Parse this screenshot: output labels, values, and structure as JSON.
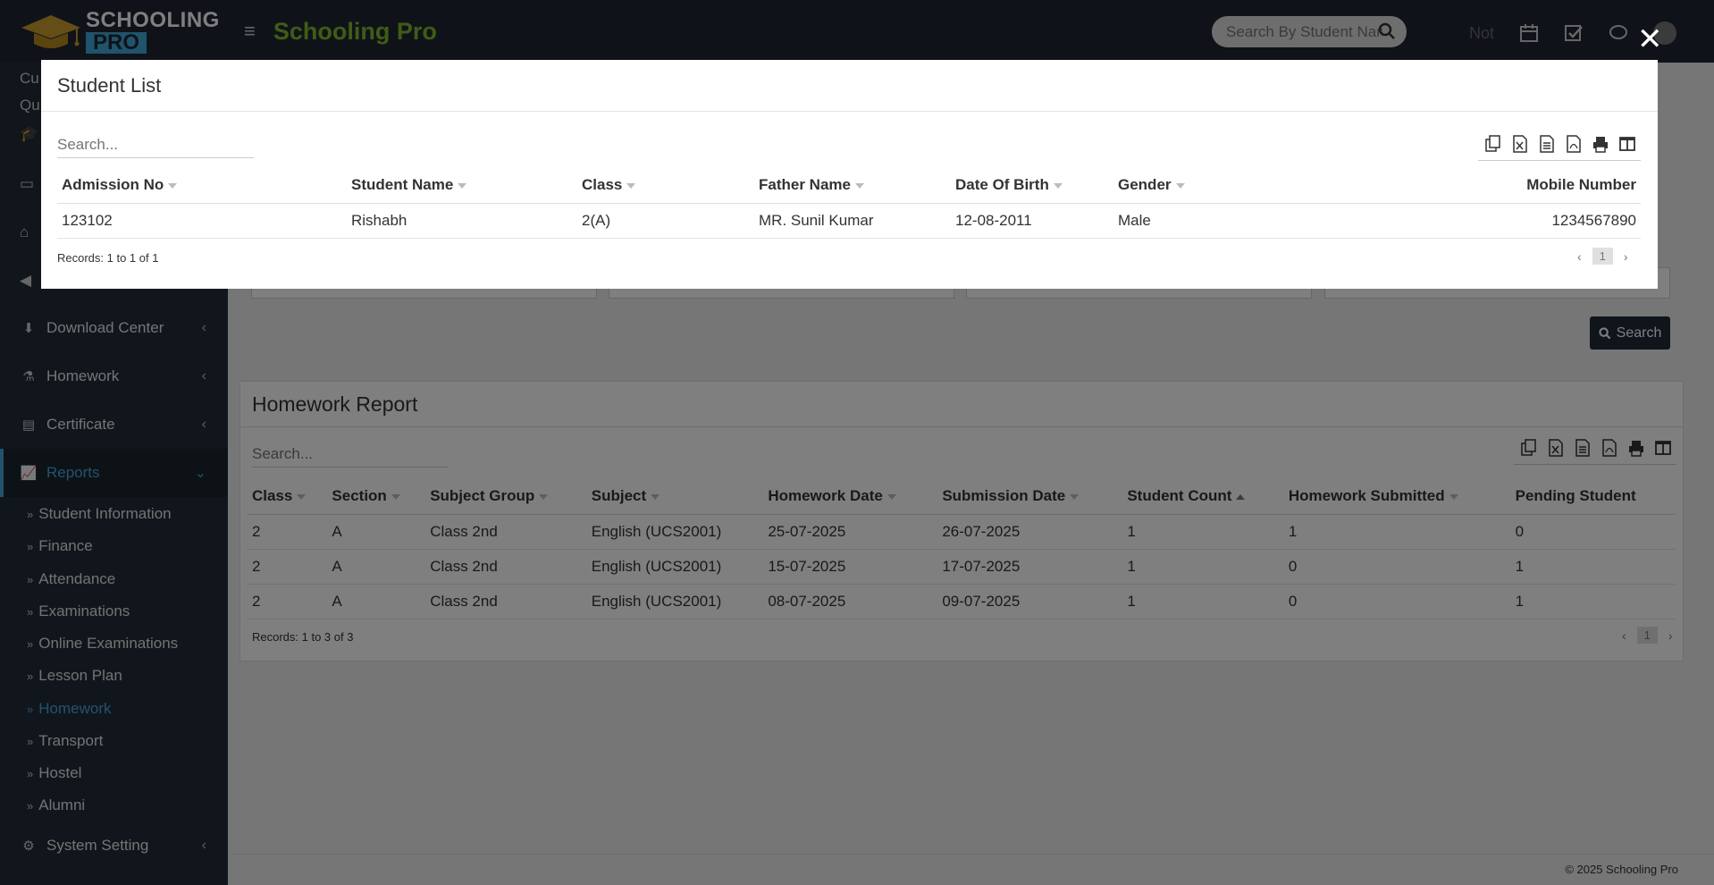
{
  "header": {
    "logo_line1": "SCHOOLING",
    "logo_line2": "PRO",
    "brand": "Schooling Pro",
    "search_placeholder": "Search By Student Name",
    "notice_text": "Not"
  },
  "sidebar": {
    "top_fragment_1": "Cu",
    "top_fragment_2": "Qu",
    "items": [
      {
        "label": "Download Center",
        "icon": "download-icon"
      },
      {
        "label": "Homework",
        "icon": "flask-icon"
      },
      {
        "label": "Certificate",
        "icon": "certificate-icon"
      },
      {
        "label": "Reports",
        "icon": "chart-line-icon"
      },
      {
        "label": "System Setting",
        "icon": "gears-icon"
      }
    ],
    "report_subitems": [
      "Student Information",
      "Finance",
      "Attendance",
      "Examinations",
      "Online Examinations",
      "Lesson Plan",
      "Homework",
      "Transport",
      "Hostel",
      "Alumni"
    ],
    "current_subitem": "Homework"
  },
  "filters": {
    "search_button": "Search"
  },
  "report": {
    "title": "Homework Report",
    "search_placeholder": "Search...",
    "columns": [
      "Class",
      "Section",
      "Subject Group",
      "Subject",
      "Homework Date",
      "Submission Date",
      "Student Count",
      "Homework Submitted",
      "Pending Student"
    ],
    "rows": [
      [
        "2",
        "A",
        "Class 2nd",
        "English (UCS2001)",
        "25-07-2025",
        "26-07-2025",
        "1",
        "1",
        "0"
      ],
      [
        "2",
        "A",
        "Class 2nd",
        "English (UCS2001)",
        "15-07-2025",
        "17-07-2025",
        "1",
        "0",
        "1"
      ],
      [
        "2",
        "A",
        "Class 2nd",
        "English (UCS2001)",
        "08-07-2025",
        "09-07-2025",
        "1",
        "0",
        "1"
      ]
    ],
    "records": "Records: 1 to 3 of 3",
    "page": "1"
  },
  "modal": {
    "title": "Student List",
    "search_placeholder": "Search...",
    "columns": [
      "Admission No",
      "Student Name",
      "Class",
      "Father Name",
      "Date Of Birth",
      "Gender",
      "Mobile Number"
    ],
    "rows": [
      [
        "123102",
        "Rishabh",
        "2(A)",
        "MR. Sunil Kumar",
        "12-08-2011",
        "Male",
        "1234567890"
      ]
    ],
    "records": "Records: 1 to 1 of 1",
    "page": "1",
    "close": "✕"
  },
  "footer": {
    "text": "© 2025 Schooling Pro"
  },
  "colors": {
    "accent": "#45a4d9",
    "brand_green": "#7fb82d",
    "sidebar_bg": "#222d38",
    "link": "#2583bd"
  }
}
